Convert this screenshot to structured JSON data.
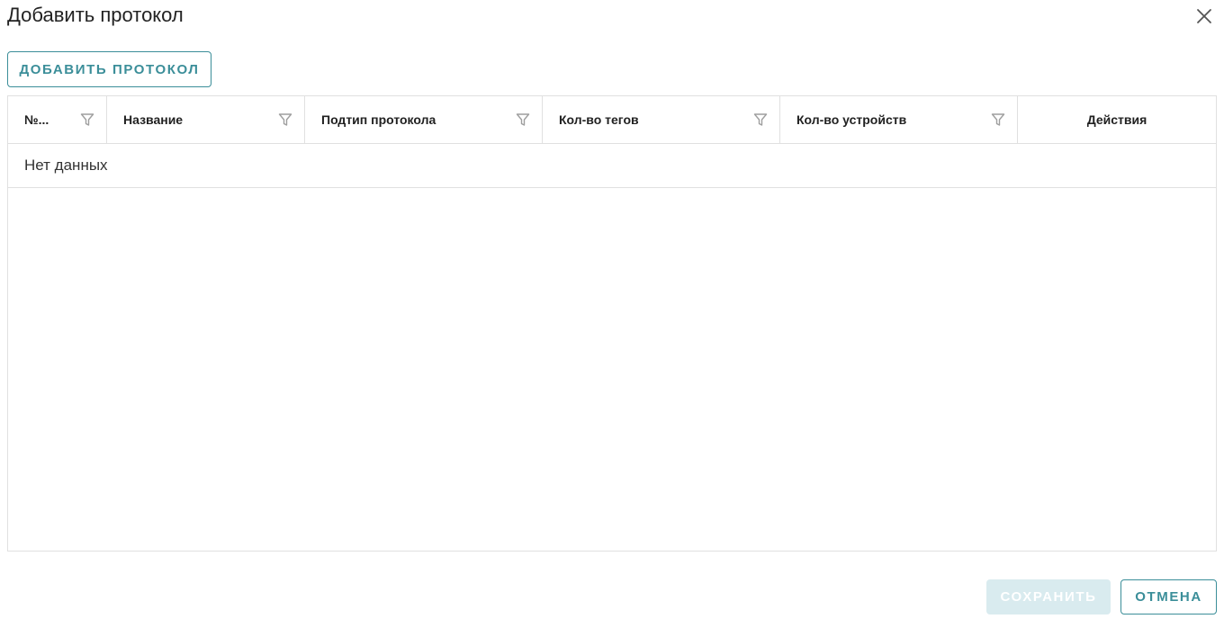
{
  "dialog": {
    "title": "Добавить протокол",
    "close_icon": "close-icon"
  },
  "toolbar": {
    "add_label": "ДОБАВИТЬ ПРОТОКОЛ"
  },
  "table": {
    "columns": [
      {
        "label": "№...",
        "filterable": true
      },
      {
        "label": "Название",
        "filterable": true
      },
      {
        "label": "Подтип протокола",
        "filterable": true
      },
      {
        "label": "Кол-во тегов",
        "filterable": true
      },
      {
        "label": "Кол-во устройств",
        "filterable": true
      },
      {
        "label": "Действия",
        "filterable": false
      }
    ],
    "empty_text": "Нет данных"
  },
  "footer": {
    "save_label": "СОХРАНИТЬ",
    "save_disabled": true,
    "cancel_label": "ОТМЕНА"
  },
  "colors": {
    "accent": "#3b8e99",
    "disabled_bg": "#d9ebef",
    "border": "#e0e0e0",
    "filter_icon": "#9e9e9e"
  }
}
